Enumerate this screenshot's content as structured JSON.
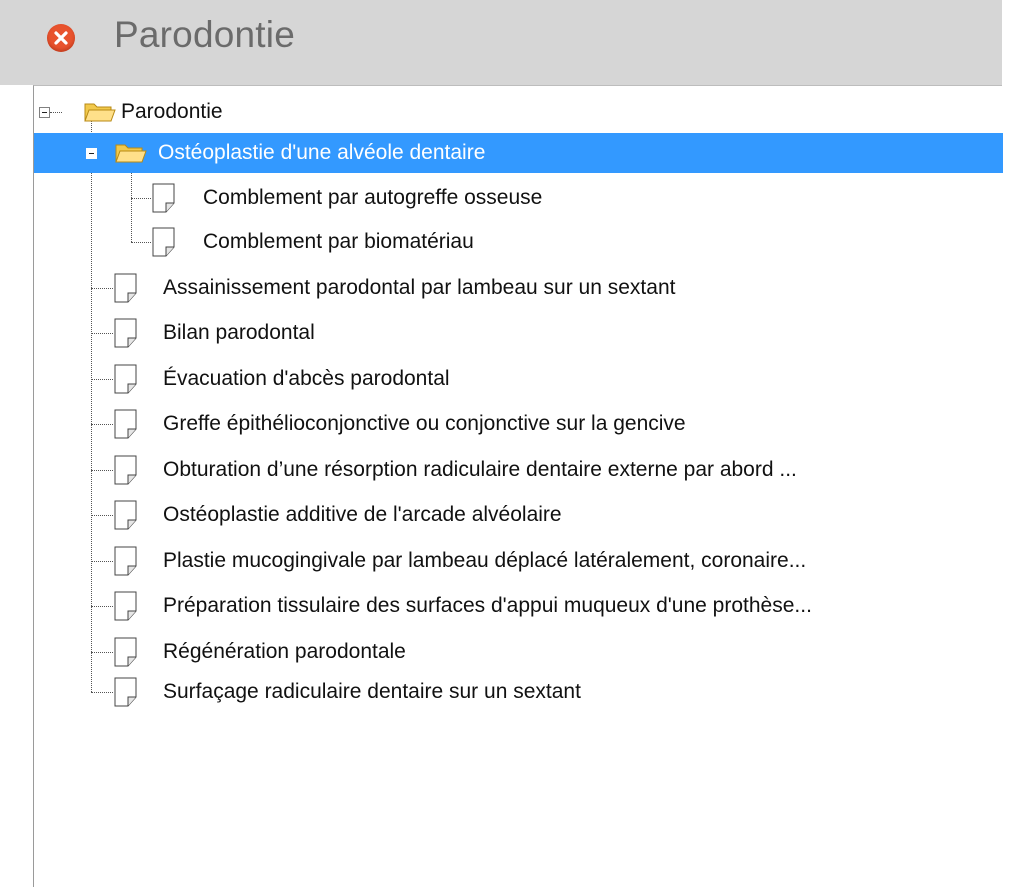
{
  "window": {
    "title": "Parodontie",
    "close_icon": "close-icon"
  },
  "tree": {
    "root": {
      "label": "Parodontie",
      "icon": "folder-open-icon",
      "expanded": true
    },
    "group": {
      "label": "Ostéoplastie d'une alvéole dentaire",
      "icon": "folder-open-icon",
      "expanded": true,
      "selected": true
    },
    "group_children": [
      "Comblement par autogreffe osseuse",
      "Comblement par biomatériau"
    ],
    "items": [
      "Assainissement parodontal par lambeau sur un sextant",
      "Bilan parodontal",
      "Évacuation d'abcès parodontal",
      "Greffe épithélioconjonctive ou conjonctive sur la gencive",
      "Obturation d’une résorption radiculaire dentaire externe par abord ...",
      "Ostéoplastie additive de l'arcade alvéolaire",
      "Plastie mucogingivale par lambeau déplacé latéralement, coronaire...",
      "Préparation tissulaire des surfaces d'appui muqueux d'une prothèse...",
      "Régénération parodontale",
      "Surfaçage radiculaire dentaire sur un sextant"
    ]
  },
  "colors": {
    "selection": "#3399ff",
    "titlebar": "#d6d6d6",
    "close_button": "#e8532e"
  }
}
